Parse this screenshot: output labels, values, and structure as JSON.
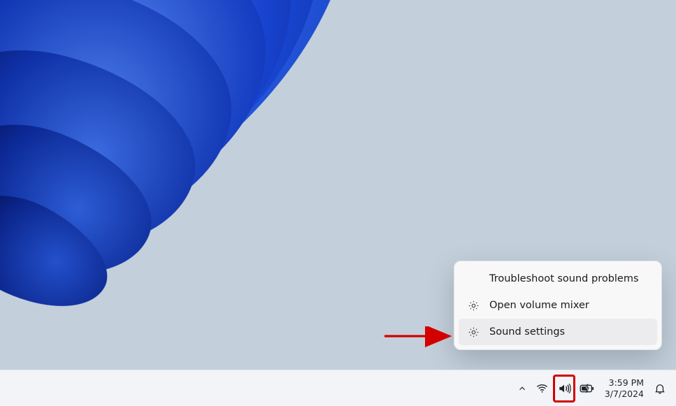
{
  "context_menu": {
    "items": [
      {
        "label": "Troubleshoot sound problems",
        "icon": null
      },
      {
        "label": "Open volume mixer",
        "icon": "gear"
      },
      {
        "label": "Sound settings",
        "icon": "gear"
      }
    ]
  },
  "taskbar": {
    "time": "3:59 PM",
    "date": "3/7/2024"
  },
  "annotations": {
    "arrow_color": "#d40000",
    "highlight_color": "#d40000"
  }
}
